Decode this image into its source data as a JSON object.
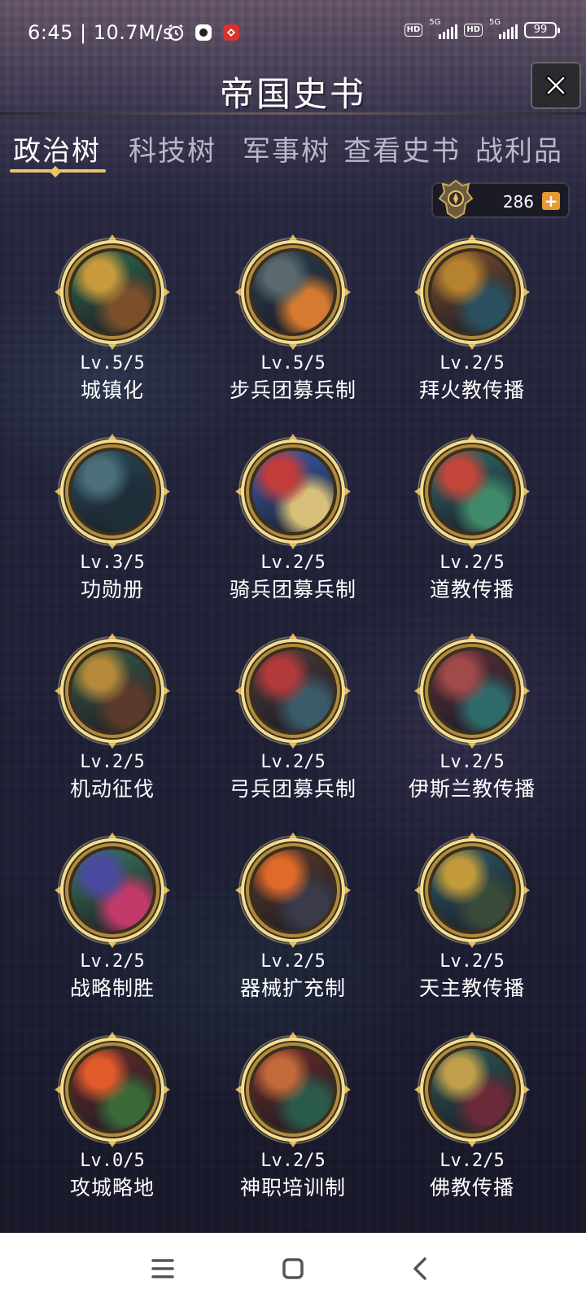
{
  "status_bar": {
    "time_speed": "6:45 | 10.7M/s",
    "signal1_label": "5G",
    "signal2_label": "5G",
    "hd_label": "HD",
    "battery": "99"
  },
  "header": {
    "title": "帝国史书"
  },
  "tabs": [
    {
      "label": "政治树"
    },
    {
      "label": "科技树"
    },
    {
      "label": "军事树"
    },
    {
      "label": "查看史书"
    },
    {
      "label": "战利品"
    }
  ],
  "currency": {
    "amount": "286",
    "plus": "+"
  },
  "policies": [
    {
      "level": "Lv.5/5",
      "name": "城镇化",
      "palette": [
        "#2f6a4a",
        "#c99a3b",
        "#7a4f2a"
      ]
    },
    {
      "level": "Lv.5/5",
      "name": "步兵团募兵制",
      "palette": [
        "#2b3e50",
        "#5a6a6f",
        "#d57a2e"
      ]
    },
    {
      "level": "Lv.2/5",
      "name": "拜火教传播",
      "palette": [
        "#7a4b2f",
        "#b5822f",
        "#2a4f5e"
      ]
    },
    {
      "level": "Lv.3/5",
      "name": "功勋册",
      "palette": [
        "#284a5a",
        "#4c6f7a",
        "#1e2f3a"
      ]
    },
    {
      "level": "Lv.2/5",
      "name": "骑兵团募兵制",
      "palette": [
        "#3b5fb0",
        "#c23c3c",
        "#d9c07a"
      ]
    },
    {
      "level": "Lv.2/5",
      "name": "道教传播",
      "palette": [
        "#2e6a6a",
        "#c2463a",
        "#3e8a6a"
      ]
    },
    {
      "level": "Lv.2/5",
      "name": "机动征伐",
      "palette": [
        "#3a5a4a",
        "#b58a3a",
        "#5a3a2a"
      ]
    },
    {
      "level": "Lv.2/5",
      "name": "弓兵团募兵制",
      "palette": [
        "#4a3a3a",
        "#b23a3a",
        "#3a5a6a"
      ]
    },
    {
      "level": "Lv.2/5",
      "name": "伊斯兰教传播",
      "palette": [
        "#5a2f3a",
        "#a04a4a",
        "#2f6a6a"
      ]
    },
    {
      "level": "Lv.2/5",
      "name": "战略制胜",
      "palette": [
        "#3a7a5a",
        "#4a4aa0",
        "#c23a6a"
      ]
    },
    {
      "level": "Lv.2/5",
      "name": "器械扩充制",
      "palette": [
        "#5a3a2a",
        "#e06a2a",
        "#3a3a4a"
      ]
    },
    {
      "level": "Lv.2/5",
      "name": "天主教传播",
      "palette": [
        "#2a5a6a",
        "#c29a3a",
        "#3a4a3a"
      ]
    },
    {
      "level": "Lv.0/5",
      "name": "攻城略地",
      "palette": [
        "#6a2a2a",
        "#e05a2a",
        "#3a6a3a"
      ]
    },
    {
      "level": "Lv.2/5",
      "name": "神职培训制",
      "palette": [
        "#6a2a2a",
        "#c26a3a",
        "#2a5a4a"
      ]
    },
    {
      "level": "Lv.2/5",
      "name": "佛教传播",
      "palette": [
        "#2a5a5a",
        "#c2a04a",
        "#6a2a3a"
      ]
    }
  ],
  "colors": {
    "gold": "#e8c46a",
    "accent_orange": "#e99933"
  }
}
